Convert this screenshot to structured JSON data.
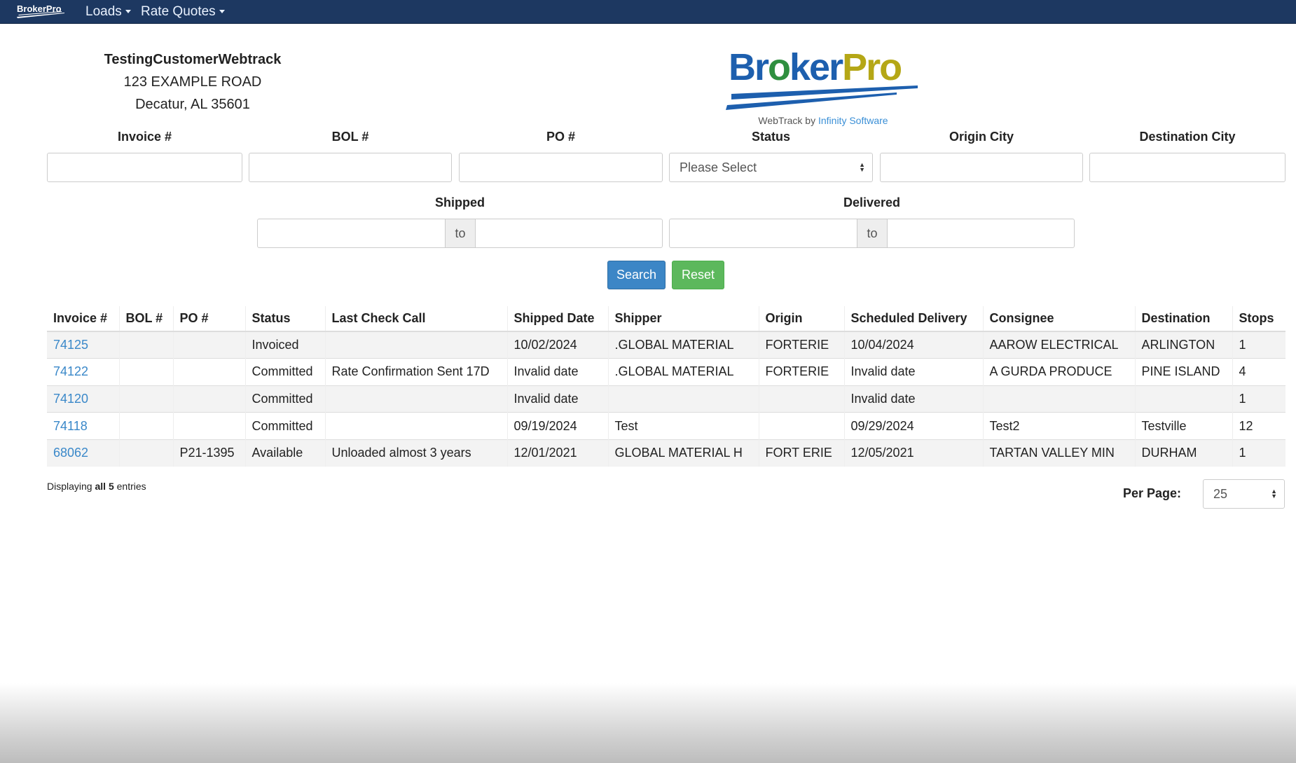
{
  "nav": {
    "brand": "BrokerPro",
    "menus": [
      {
        "label": "Loads"
      },
      {
        "label": "Rate Quotes"
      }
    ]
  },
  "company": {
    "name": "TestingCustomerWebtrack",
    "address": "123 EXAMPLE ROAD",
    "city": "Decatur, AL 35601"
  },
  "logo": {
    "text": "BrokerPro",
    "tagline_prefix": "WebTrack by",
    "tagline_link": "Infinity Software"
  },
  "filters": {
    "invoice_label": "Invoice #",
    "bol_label": "BOL #",
    "po_label": "PO #",
    "status_label": "Status",
    "status_value": "Please Select",
    "origin_label": "Origin City",
    "destination_label": "Destination City",
    "shipped_label": "Shipped",
    "delivered_label": "Delivered",
    "to": "to"
  },
  "buttons": {
    "search": "Search",
    "reset": "Reset"
  },
  "colors": {
    "nav": "#1d3861",
    "link": "#3a88c9",
    "search": "#3c86c6",
    "reset": "#5cb85c"
  },
  "table": {
    "headers": [
      "Invoice #",
      "BOL #",
      "PO #",
      "Status",
      "Last Check Call",
      "Shipped Date",
      "Shipper",
      "Origin",
      "Scheduled Delivery",
      "Consignee",
      "Destination",
      "Stops"
    ],
    "rows": [
      [
        "74125",
        "",
        "",
        "Invoiced",
        "",
        "10/02/2024",
        ".GLOBAL MATERIAL",
        "FORTERIE",
        "10/04/2024",
        "AAROW ELECTRICAL",
        "ARLINGTON",
        "1"
      ],
      [
        "74122",
        "",
        "",
        "Committed",
        "Rate Confirmation Sent 17D",
        "Invalid date",
        ".GLOBAL MATERIAL",
        "FORTERIE",
        "Invalid date",
        "A GURDA PRODUCE",
        "PINE ISLAND",
        "4"
      ],
      [
        "74120",
        "",
        "",
        "Committed",
        "",
        "Invalid date",
        "",
        "",
        "Invalid date",
        "",
        "",
        "1"
      ],
      [
        "74118",
        "",
        "",
        "Committed",
        "",
        "09/19/2024",
        "Test",
        "",
        "09/29/2024",
        "Test2",
        "Testville",
        "12"
      ],
      [
        "68062",
        "",
        "P21-1395",
        "Available",
        "Unloaded almost 3 years",
        "12/01/2021",
        "GLOBAL MATERIAL H",
        "FORT ERIE",
        "12/05/2021",
        "TARTAN VALLEY MIN",
        "DURHAM",
        "1"
      ]
    ]
  },
  "footer": {
    "display_prefix": "Displaying",
    "display_bold": "all 5",
    "display_suffix": "entries",
    "per_page_label": "Per Page:",
    "per_page_value": "25"
  }
}
